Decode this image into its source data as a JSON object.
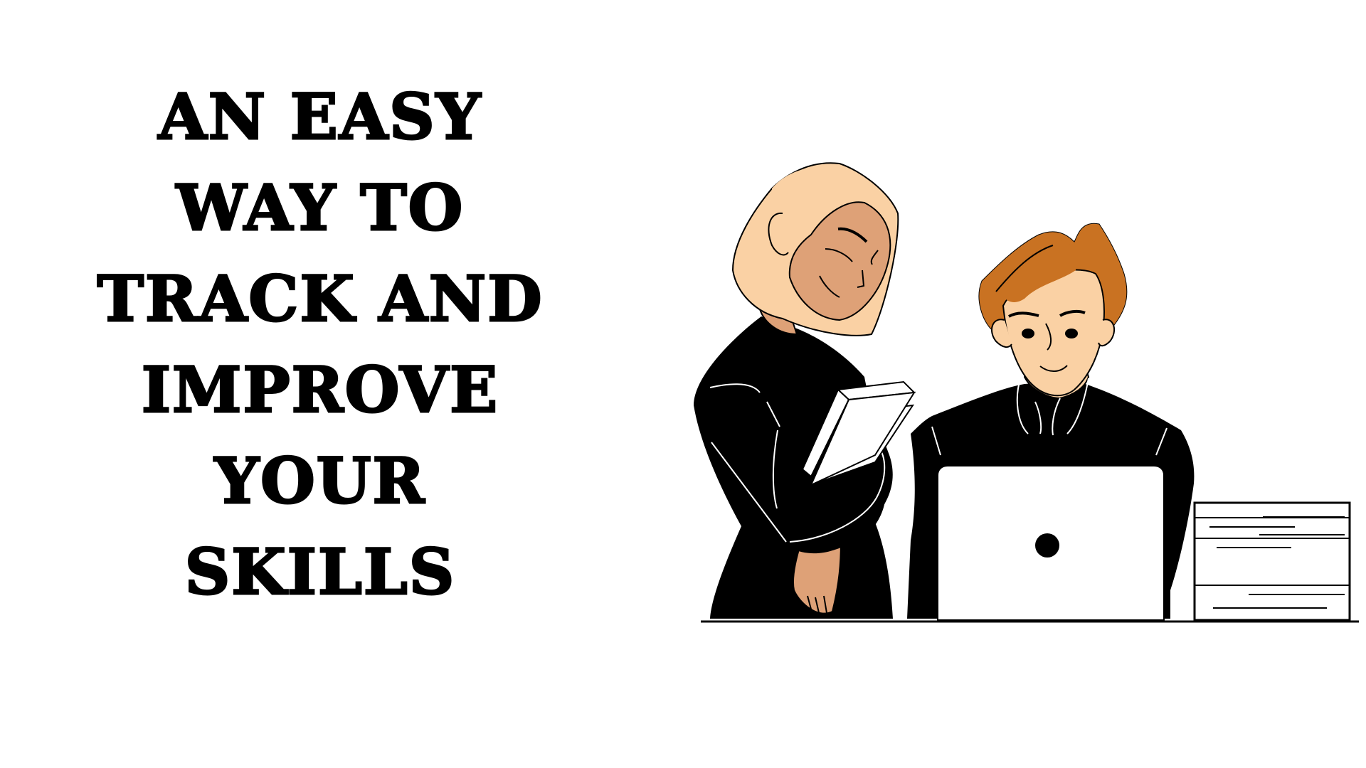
{
  "headline": {
    "lines": [
      "AN EASY",
      "WAY TO",
      "TRACK AND",
      "IMPROVE",
      "YOUR",
      "SKILLS"
    ]
  },
  "illustration": {
    "subject": "two people looking at a laptop, woman holding a book, filing drawer on the right",
    "colors": {
      "clothing": "#000000",
      "woman_hair": "#FAD1A4",
      "woman_skin": "#DEA177",
      "man_hair": "#C97222",
      "man_skin": "#FAD1A4",
      "laptop": "#FFFFFF",
      "background": "#FFFFFF"
    }
  }
}
